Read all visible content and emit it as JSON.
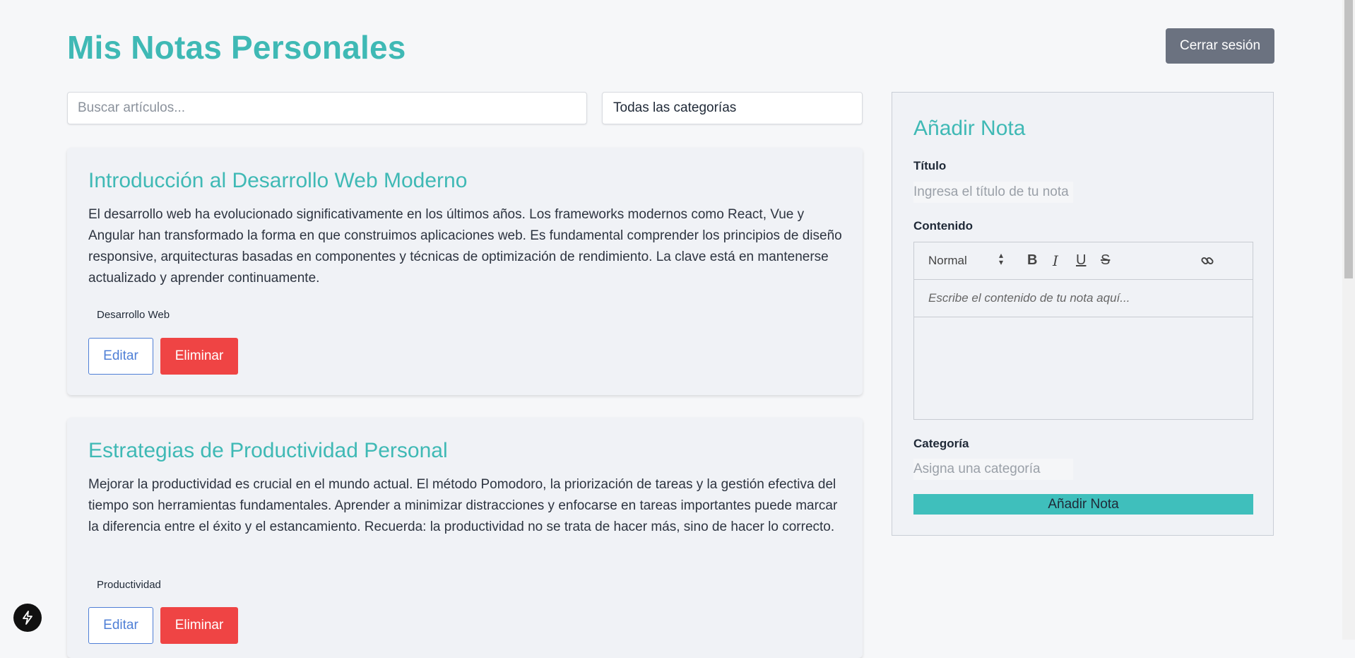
{
  "header": {
    "title": "Mis Notas Personales",
    "logout_label": "Cerrar sesión"
  },
  "filters": {
    "search_placeholder": "Buscar artículos...",
    "category_selected": "Todas las categorías"
  },
  "notes": [
    {
      "title": "Introducción al Desarrollo Web Moderno",
      "body": "El desarrollo web ha evolucionado significativamente en los últimos años. Los frameworks modernos como React, Vue y Angular han transformado la forma en que construimos aplicaciones web. Es fundamental comprender los principios de diseño responsive, arquitecturas basadas en componentes y técnicas de optimización de rendimiento. La clave está en mantenerse actualizado y aprender continuamente.",
      "category": "Desarrollo Web",
      "edit_label": "Editar",
      "delete_label": "Eliminar"
    },
    {
      "title": "Estrategias de Productividad Personal",
      "body": "Mejorar la productividad es crucial en el mundo actual. El método Pomodoro, la priorización de tareas y la gestión efectiva del tiempo son herramientas fundamentales. Aprender a minimizar distracciones y enfocarse en tareas importantes puede marcar la diferencia entre el éxito y el estancamiento. Recuerda: la productividad no se trata de hacer más, sino de hacer lo correcto.",
      "category": "Productividad",
      "edit_label": "Editar",
      "delete_label": "Eliminar"
    }
  ],
  "add_note": {
    "title": "Añadir Nota",
    "title_label": "Título",
    "title_placeholder": "Ingresa el título de tu nota",
    "content_label": "Contenido",
    "format_selected": "Normal",
    "content_placeholder": "Escribe el contenido de tu nota aquí...",
    "category_label": "Categoría",
    "category_placeholder": "Asigna una categoría",
    "submit_label": "Añadir Nota"
  },
  "toolbar_icons": [
    "bold-icon",
    "italic-icon",
    "underline-icon",
    "strikethrough-icon",
    "link-icon"
  ],
  "colors": {
    "accent": "#3fb9b5",
    "danger": "#ef4444",
    "edit_blue": "#4f7fd6",
    "logout_gray": "#6b7280"
  }
}
